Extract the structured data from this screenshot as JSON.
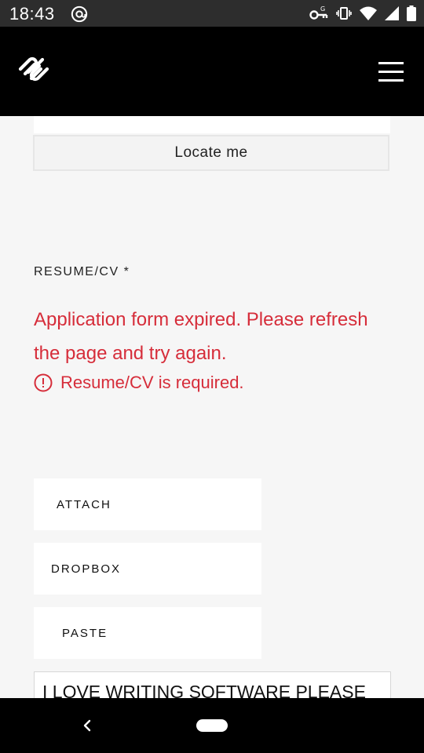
{
  "status_bar": {
    "time": "18:43",
    "icons": [
      "at-sign-icon",
      "vpn-key-icon",
      "vibrate-icon",
      "wifi-icon",
      "signal-icon",
      "battery-icon"
    ]
  },
  "header": {
    "logo": "squarespace-logo-icon",
    "menu_icon": "hamburger-menu-icon"
  },
  "form": {
    "locate_button": "Locate me",
    "resume_label": "RESUME/CV *",
    "error_message": "Application form expired. Please refresh the page and try again.",
    "required_message": "Resume/CV is required.",
    "attach_button": "ATTACH",
    "dropbox_button": "DROPBOX",
    "paste_button": "PASTE",
    "text_value": "I LOVE WRITING SOFTWARE PLEASE"
  },
  "colors": {
    "error": "#d62d3a",
    "header_bg": "#000000",
    "page_bg": "#f6f6f6"
  }
}
